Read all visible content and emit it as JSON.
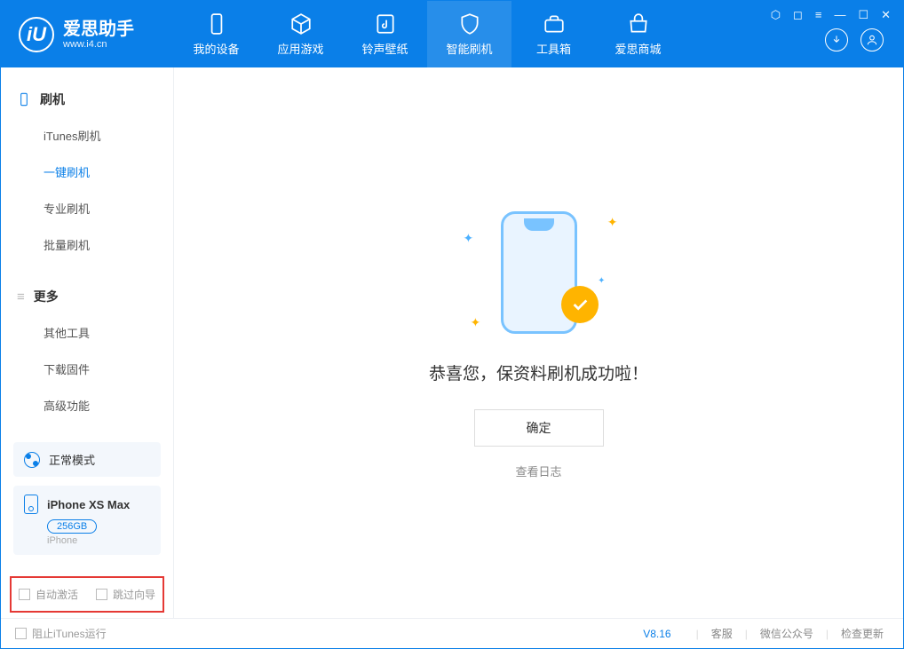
{
  "app": {
    "title": "爱思助手",
    "subtitle": "www.i4.cn"
  },
  "nav": [
    {
      "label": "我的设备",
      "icon": "device"
    },
    {
      "label": "应用游戏",
      "icon": "cube"
    },
    {
      "label": "铃声壁纸",
      "icon": "music"
    },
    {
      "label": "智能刷机",
      "icon": "shield",
      "active": true
    },
    {
      "label": "工具箱",
      "icon": "toolbox"
    },
    {
      "label": "爱思商城",
      "icon": "store"
    }
  ],
  "sidebar": {
    "group1_title": "刷机",
    "group1_items": [
      "iTunes刷机",
      "一键刷机",
      "专业刷机",
      "批量刷机"
    ],
    "group1_active_index": 1,
    "group2_title": "更多",
    "group2_items": [
      "其他工具",
      "下载固件",
      "高级功能"
    ]
  },
  "device": {
    "mode": "正常模式",
    "name": "iPhone XS Max",
    "storage": "256GB",
    "type": "iPhone"
  },
  "options": {
    "auto_activate": "自动激活",
    "skip_guide": "跳过向导"
  },
  "main": {
    "message": "恭喜您，保资料刷机成功啦！",
    "ok": "确定",
    "view_log": "查看日志"
  },
  "footer": {
    "block_itunes": "阻止iTunes运行",
    "version": "V8.16",
    "links": [
      "客服",
      "微信公众号",
      "检查更新"
    ]
  }
}
